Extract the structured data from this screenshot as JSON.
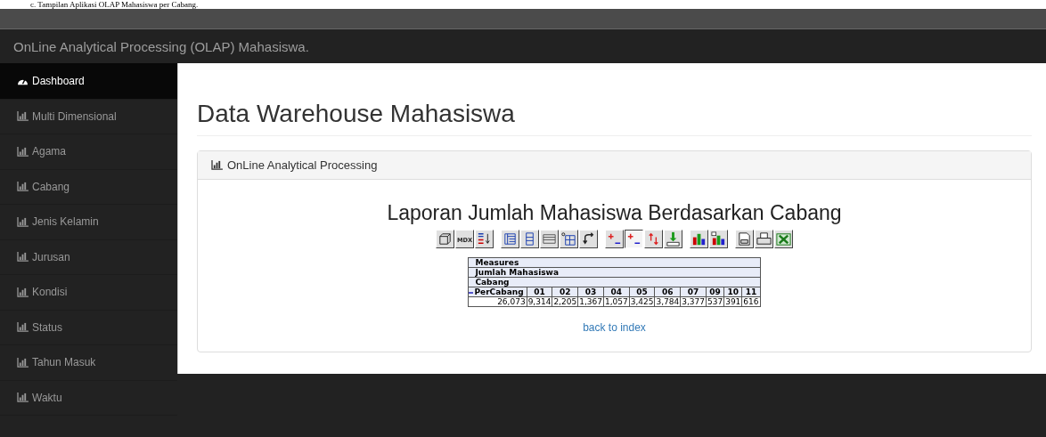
{
  "caption": "c. Tampilan Aplikasi OLAP Mahasiswa per Cabang.",
  "navbar": {
    "brand": "OnLine Analytical Processing (OLAP) Mahasiswa."
  },
  "sidebar": {
    "items": [
      {
        "label": "Dashboard",
        "kind": "dashboard",
        "selected": true
      },
      {
        "label": "Multi Dimensional",
        "kind": "chart",
        "selected": false
      },
      {
        "label": "Agama",
        "kind": "chart",
        "selected": false
      },
      {
        "label": "Cabang",
        "kind": "chart",
        "selected": false
      },
      {
        "label": "Jenis Kelamin",
        "kind": "chart",
        "selected": false
      },
      {
        "label": "Jurusan",
        "kind": "chart",
        "selected": false
      },
      {
        "label": "Kondisi",
        "kind": "chart",
        "selected": false
      },
      {
        "label": "Status",
        "kind": "chart",
        "selected": false
      },
      {
        "label": "Tahun Masuk",
        "kind": "chart",
        "selected": false
      },
      {
        "label": "Waktu",
        "kind": "chart",
        "selected": false
      }
    ]
  },
  "page_title": "Data Warehouse Mahasiswa",
  "panel": {
    "title": "OnLine Analytical Processing",
    "report_title": "Laporan Jumlah Mahasiswa Berdasarkan Cabang",
    "toolbar": [
      [
        {
          "kind": "cube",
          "pressed": false
        },
        {
          "kind": "mdx",
          "label": "MDX",
          "pressed": false
        },
        {
          "kind": "sort",
          "pressed": false
        }
      ],
      [
        {
          "kind": "tree",
          "pressed": false
        },
        {
          "kind": "column",
          "pressed": false
        },
        {
          "kind": "table",
          "pressed": false
        },
        {
          "kind": "zero-grid",
          "pressed": false
        },
        {
          "kind": "swap",
          "pressed": false
        }
      ],
      [
        {
          "kind": "expand",
          "pressed": false
        },
        {
          "kind": "expand",
          "pressed": true
        },
        {
          "kind": "updown",
          "pressed": false
        },
        {
          "kind": "drill",
          "pressed": false
        }
      ],
      [
        {
          "kind": "chart",
          "pressed": false
        },
        {
          "kind": "chart-config",
          "pressed": false
        }
      ],
      [
        {
          "kind": "print-setup",
          "pressed": false
        },
        {
          "kind": "print",
          "pressed": false
        },
        {
          "kind": "excel",
          "pressed": false
        }
      ]
    ],
    "table": {
      "header_rows": [
        "Measures",
        "Jumlah Mahasiswa",
        "Cabang"
      ],
      "columns": [
        "PerCabang",
        "01",
        "02",
        "03",
        "04",
        "05",
        "06",
        "07",
        "09",
        "10",
        "11"
      ],
      "values": [
        "26,073",
        "9,314",
        "2,205",
        "1,367",
        "1,057",
        "3,425",
        "3,784",
        "3,377",
        "537",
        "391",
        "616"
      ]
    },
    "link": "back to index"
  }
}
